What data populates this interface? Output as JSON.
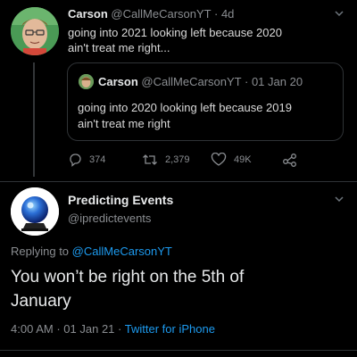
{
  "tweet1": {
    "name": "Carson",
    "handle": "@CallMeCarsonYT",
    "sep": "·",
    "time": "4d",
    "text_line1": "going into 2021 looking left because 2020",
    "text_line2": "ain't treat me right...",
    "quoted": {
      "name": "Carson",
      "handle": "@CallMeCarsonYT",
      "sep": "·",
      "date": "01 Jan 20",
      "text_line1": "going into 2020 looking left because 2019",
      "text_line2": "ain't treat me right"
    },
    "actions": {
      "reply_count": "374",
      "retweet_count": "2,379",
      "like_count": "49K"
    }
  },
  "tweet2": {
    "name": "Predicting Events",
    "handle": "@ipredictevents",
    "replying_prefix": "Replying to",
    "replying_to": "@CallMeCarsonYT",
    "text_line1": "You won’t be right on the 5th of",
    "text_line2": "January",
    "time": "4:00 AM",
    "sep1": "·",
    "date": "01 Jan 21",
    "sep2": "·",
    "source": "Twitter for iPhone"
  },
  "icons": {
    "chevron": "chevron-down-icon",
    "reply": "reply-icon",
    "retweet": "retweet-icon",
    "like": "heart-icon",
    "share": "share-icon"
  },
  "colors": {
    "background": "#000000",
    "link": "#1d9bf0",
    "muted": "#8a8d91",
    "text": "#d9d9d9"
  }
}
